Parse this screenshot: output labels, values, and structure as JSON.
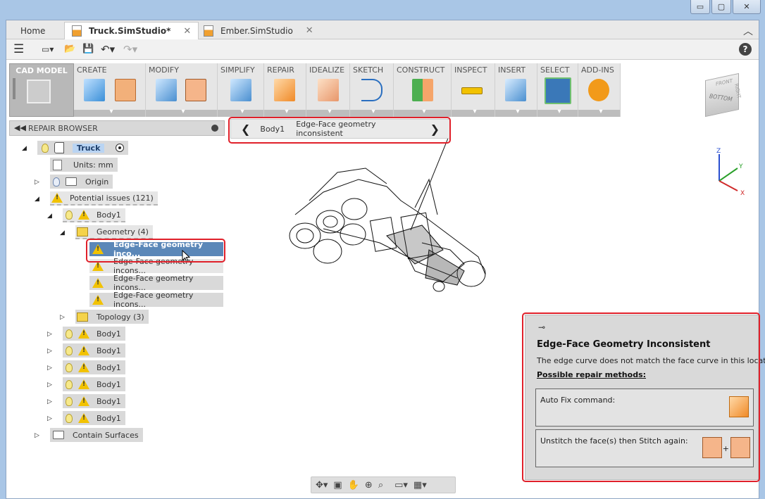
{
  "window": {
    "minimize": "▭",
    "restore": "▢",
    "close": "✕"
  },
  "tabs": [
    {
      "label": "Home"
    },
    {
      "label": "Truck.SimStudio*"
    },
    {
      "label": "Ember.SimStudio"
    }
  ],
  "tab_close": "✕",
  "tab_chevron": "︿",
  "quickbar": {
    "menu_icon": "☰",
    "new_icon": "▭▾",
    "open_icon": "📂",
    "save_icon": "💾",
    "undo_icon": "↶▾",
    "redo_icon": "↷▾",
    "help_label": "?"
  },
  "ribbon": {
    "cad_model": "CAD MODEL",
    "panels": [
      {
        "label": "CREATE"
      },
      {
        "label": "MODIFY"
      },
      {
        "label": "SIMPLIFY"
      },
      {
        "label": "REPAIR"
      },
      {
        "label": "IDEALIZE"
      },
      {
        "label": "SKETCH"
      },
      {
        "label": "CONSTRUCT"
      },
      {
        "label": "INSPECT"
      },
      {
        "label": "INSERT"
      },
      {
        "label": "SELECT"
      },
      {
        "label": "ADD-INS"
      }
    ]
  },
  "browser": {
    "collapse_icon": "◀◀",
    "title": "REPAIR BROWSER",
    "root": "Truck",
    "units": "Units: mm",
    "origin": "Origin",
    "potential_issues": "Potential issues (121)",
    "body": "Body1",
    "geometry": "Geometry (4)",
    "issue_selected": "Edge-Face geometry inco...",
    "issue_item": "Edge-Face geometry incons...",
    "topology": "Topology (3)",
    "contain_surfaces": "Contain Surfaces"
  },
  "breadcrumb": {
    "prev": "❮",
    "body": "Body1",
    "issue": "Edge-Face geometry inconsistent",
    "next": "❯"
  },
  "issue_panel": {
    "pin_icon": "⊸",
    "title": "Edge-Face Geometry Inconsistent",
    "description": "The edge curve does not match the face curve in this location.",
    "methods_heading": "Possible repair methods:",
    "method_1": "Auto Fix command:",
    "method_2": "Unstitch the face(s) then Stitch again:",
    "plus": "+"
  },
  "viewcube": {
    "front": "FRONT",
    "right": "RIGHT",
    "bottom": "BOTTOM"
  },
  "triad": {
    "x": "X",
    "y": "Y",
    "z": "Z"
  },
  "navbar": {
    "orbit": "✥▾",
    "look": "▣",
    "pan": "✋",
    "zoom": "⊕",
    "fit": "⌕",
    "display": "▭▾",
    "grid": "▦▾"
  }
}
